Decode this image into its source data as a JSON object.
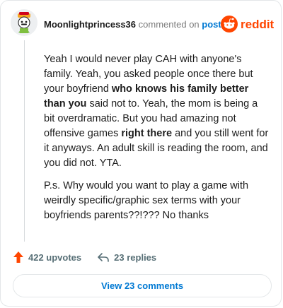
{
  "comment": {
    "username": "Moonlightprincess36",
    "action_text": "commented on",
    "post_link": "post",
    "brand": "reddit",
    "paragraphs": [
      [
        {
          "text": "Yeah I would never play CAH with anyone's family. Yeah, you asked people once there but your boyfriend ",
          "bold": false
        },
        {
          "text": "who knows his family better than you",
          "bold": true
        },
        {
          "text": " said not to. Yeah, the mom is being a bit overdramatic. But you had amazing not offensive games ",
          "bold": false
        },
        {
          "text": "right there",
          "bold": true
        },
        {
          "text": " and you still went for it anyways. An adult skill is reading the room, and you did not. YTA.",
          "bold": false
        }
      ],
      [
        {
          "text": "P.s. Why would you want to play a game with weirdly specific/graphic sex terms with your boyfriends parents??!??? No thanks",
          "bold": false
        }
      ]
    ],
    "upvotes_label": "422 upvotes",
    "replies_label": "23 replies",
    "view_comments_label": "View 23 comments",
    "colors": {
      "upvote": "#ff4500",
      "link": "#0079d3",
      "brand": "#ff4500"
    }
  }
}
